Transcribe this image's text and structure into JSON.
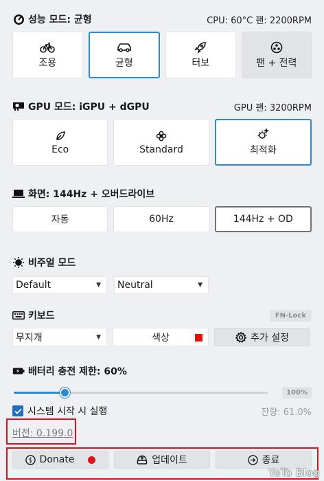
{
  "perf": {
    "title": "성능 모드: 균형",
    "status": "CPU: 60°C 팬: 2200RPM",
    "modes": [
      {
        "label": "조용",
        "icon": "bicycle-icon"
      },
      {
        "label": "균형",
        "icon": "car-icon"
      },
      {
        "label": "터보",
        "icon": "rocket-icon"
      },
      {
        "label": "팬 + 전력",
        "icon": "fan-icon"
      }
    ]
  },
  "gpu": {
    "title": "GPU 모드: iGPU + dGPU",
    "status": "GPU 팬: 3200RPM",
    "modes": [
      {
        "label": "Eco",
        "icon": "leaf-icon"
      },
      {
        "label": "Standard",
        "icon": "flower-icon"
      },
      {
        "label": "최적화",
        "icon": "sparkle-icon"
      }
    ]
  },
  "screen": {
    "title": "화면: 144Hz + 오버드라이브",
    "options": [
      "자동",
      "60Hz",
      "144Hz + OD"
    ]
  },
  "visual": {
    "title": "비주얼 모드",
    "select1": "Default",
    "select2": "Neutral"
  },
  "keyboard": {
    "title": "키보드",
    "fnlock": "FN-Lock",
    "effect": "무지개",
    "color_label": "색상",
    "color_swatch": "#e3120b",
    "settings_label": "추가 설정"
  },
  "battery": {
    "title": "배터리 충전 제한: 60%",
    "limit_percent": 60,
    "badge": "100%",
    "startup_label": "시스템 시작 시 실행",
    "remaining": "잔량: 61.0%"
  },
  "footer": {
    "version": "버전: 0.199.0",
    "donate": "Donate",
    "update": "업데이트",
    "quit": "종료",
    "watermark": "YoTo Blog"
  },
  "colors": {
    "accent": "#2b8ad6",
    "highlight_red": "#e0101c"
  }
}
